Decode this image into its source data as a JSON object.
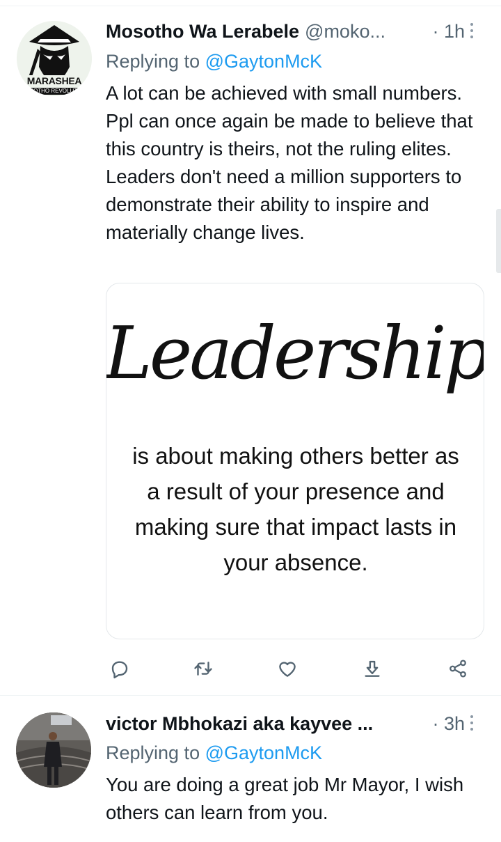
{
  "tweets": [
    {
      "display_name": "Mosotho Wa Lerabele",
      "handle": "@moko...",
      "time": "· 1h",
      "replying_to_label": "Replying to",
      "replying_to_handle": "@GaytonMcK",
      "text": "A lot can be achieved with small numbers. Ppl can once again be made to believe that this country is theirs, not the ruling elites. Leaders don't need a million supporters to demonstrate their ability to inspire and materially change lives.",
      "avatar_text": "MARASHEA",
      "avatar_subtext": "SOTHO REVOLUTI",
      "media": {
        "title": "Leadership",
        "quote": "is about making others better as a result of your presence and making sure that impact lasts in your absence."
      },
      "actions": [
        "reply-icon",
        "retweet-icon",
        "like-icon",
        "download-icon",
        "share-icon"
      ]
    },
    {
      "display_name": "victor Mbhokazi aka kayvee ...",
      "handle": "",
      "time": "· 3h",
      "replying_to_label": "Replying to",
      "replying_to_handle": "@GaytonMcK",
      "text": "You are doing a great job Mr Mayor, I wish others can learn from you."
    }
  ],
  "colors": {
    "text_primary": "#0f1419",
    "text_secondary": "#536471",
    "link": "#1d9bf0",
    "divider": "#eff3f4",
    "icon": "#536471"
  }
}
